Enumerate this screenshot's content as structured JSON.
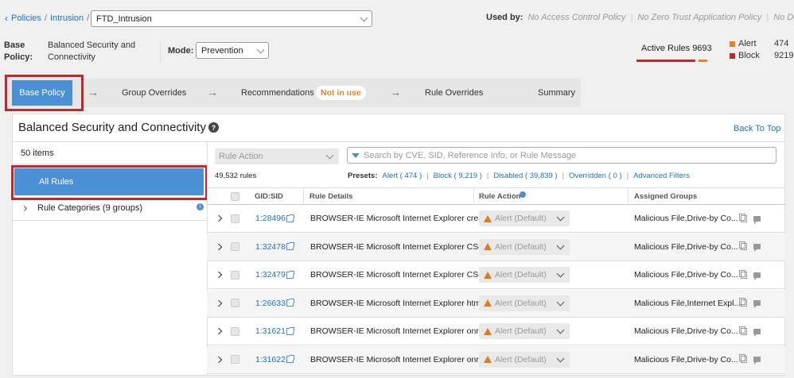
{
  "breadcrumb": {
    "policies": "Policies",
    "sep1": "/",
    "intrusion": "Intrusion",
    "sep2": "/"
  },
  "policy_select": "FTD_Intrusion",
  "used_by": {
    "label": "Used by:",
    "access": "No Access Control Policy",
    "zero_trust": "No Zero Trust Application Policy",
    "device": "No Device"
  },
  "base_policy": {
    "label_line1": "Base",
    "label_line2": "Policy:",
    "value_line1": "Balanced Security and",
    "value_line2": "Connectivity"
  },
  "mode": {
    "label": "Mode:",
    "value": "Prevention"
  },
  "active_rules": {
    "label": "Active Rules 9693",
    "alert_label": "Alert",
    "alert_count": "474",
    "block_label": "Block",
    "block_count": "9219",
    "alert_color": "#e8822a",
    "block_color": "#c0282d"
  },
  "steps": {
    "base_policy": "Base Policy",
    "group_overrides": "Group Overrides",
    "recommendations": "Recommendations",
    "not_in_use": "Not in use",
    "rule_overrides": "Rule Overrides",
    "summary": "Summary",
    "arrow": "→"
  },
  "panel": {
    "title": "Balanced Security and Connectivity",
    "help": "?",
    "back_to_top": "Back To Top"
  },
  "sidebar": {
    "count": "50 items",
    "all_rules": "All Rules",
    "categories": "Rule Categories (9 groups)"
  },
  "filters": {
    "rule_action_placeholder": "Rule Action",
    "search_placeholder": "Search by CVE, SID, Reference Info, or Rule Message",
    "rules_count": "49,532 rules",
    "presets_label": "Presets:",
    "alert": "Alert ( 474 )",
    "block": "Block ( 9,219 )",
    "disabled": "Disabled ( 39,839 )",
    "overridden": "Overridden ( 0 )",
    "advanced": "Advanced Filters",
    "sep": "|"
  },
  "table": {
    "headers": {
      "gid": "GID:SID",
      "details": "Rule Details",
      "action": "Rule Action",
      "groups": "Assigned Groups"
    },
    "rows": [
      {
        "gid": "1:28496",
        "details": "BROWSER-IE Microsoft Internet Explorer crea...",
        "action": "Alert (Default)",
        "groups": "Malicious File,Drive-by Co..."
      },
      {
        "gid": "1:32478",
        "details": "BROWSER-IE Microsoft Internet Explorer CSe...",
        "action": "Alert (Default)",
        "groups": "Malicious File,Drive-by Co..."
      },
      {
        "gid": "1:32479",
        "details": "BROWSER-IE Microsoft Internet Explorer CSe...",
        "action": "Alert (Default)",
        "groups": "Malicious File,Drive-by Co..."
      },
      {
        "gid": "1:26633",
        "details": "BROWSER-IE Microsoft Internet Explorer html...",
        "action": "Alert (Default)",
        "groups": "Malicious File,Internet Expl..."
      },
      {
        "gid": "1:31621",
        "details": "BROWSER-IE Microsoft Internet Explorer onre...",
        "action": "Alert (Default)",
        "groups": "Malicious File,Drive-by Co..."
      },
      {
        "gid": "1:31622",
        "details": "BROWSER-IE Microsoft Internet Explorer onre...",
        "action": "Alert (Default)",
        "groups": "Malicious File,Drive-by Co..."
      }
    ]
  }
}
